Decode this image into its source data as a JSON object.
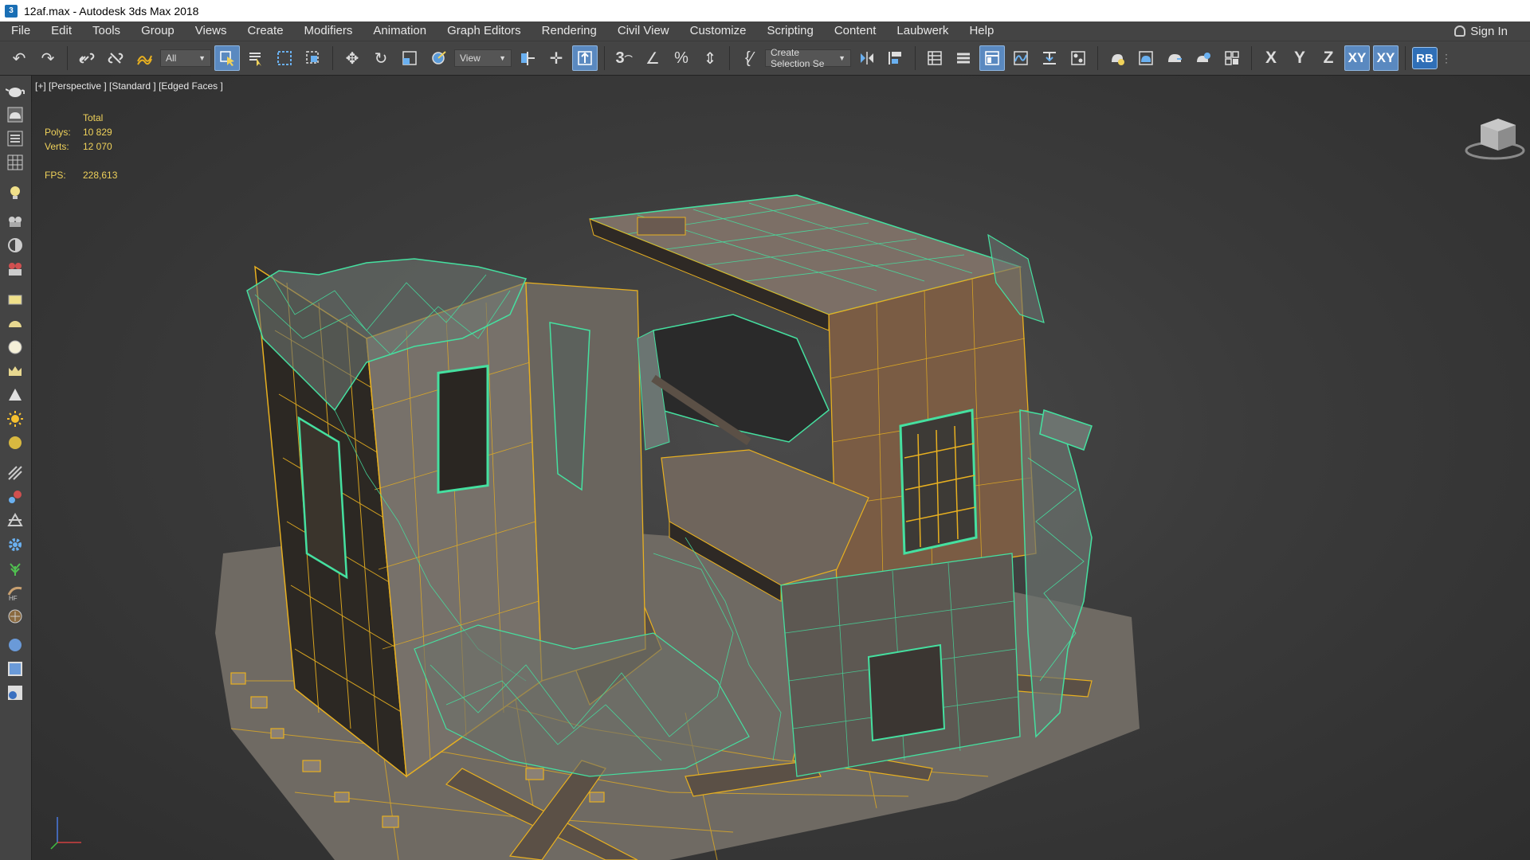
{
  "window": {
    "title": "12af.max - Autodesk 3ds Max 2018",
    "app_icon": "3ds-max-icon"
  },
  "menu": {
    "items": [
      "File",
      "Edit",
      "Tools",
      "Group",
      "Views",
      "Create",
      "Modifiers",
      "Animation",
      "Graph Editors",
      "Rendering",
      "Civil View",
      "Customize",
      "Scripting",
      "Content",
      "Laubwerk",
      "Help"
    ],
    "sign_in": "Sign In"
  },
  "toolbar": {
    "selection_filter": "All",
    "reference_coord": "View",
    "selection_set": "Create Selection Se",
    "axis_x": "X",
    "axis_y": "Y",
    "axis_z": "Z",
    "axis_xy": "XY",
    "axis_xy2": "XY",
    "rb_label": "RB"
  },
  "viewport": {
    "label": "[+] [Perspective ] [Standard ] [Edged Faces ]",
    "stats": {
      "total_label": "Total",
      "polys_label": "Polys:",
      "polys_value": "10 829",
      "verts_label": "Verts:",
      "verts_value": "12 070",
      "fps_label": "FPS:",
      "fps_value": "228,613"
    },
    "colors": {
      "wire_green": "#45e0a0",
      "wire_yellow": "#e8b020",
      "stats_yellow": "#f0d25a"
    }
  }
}
